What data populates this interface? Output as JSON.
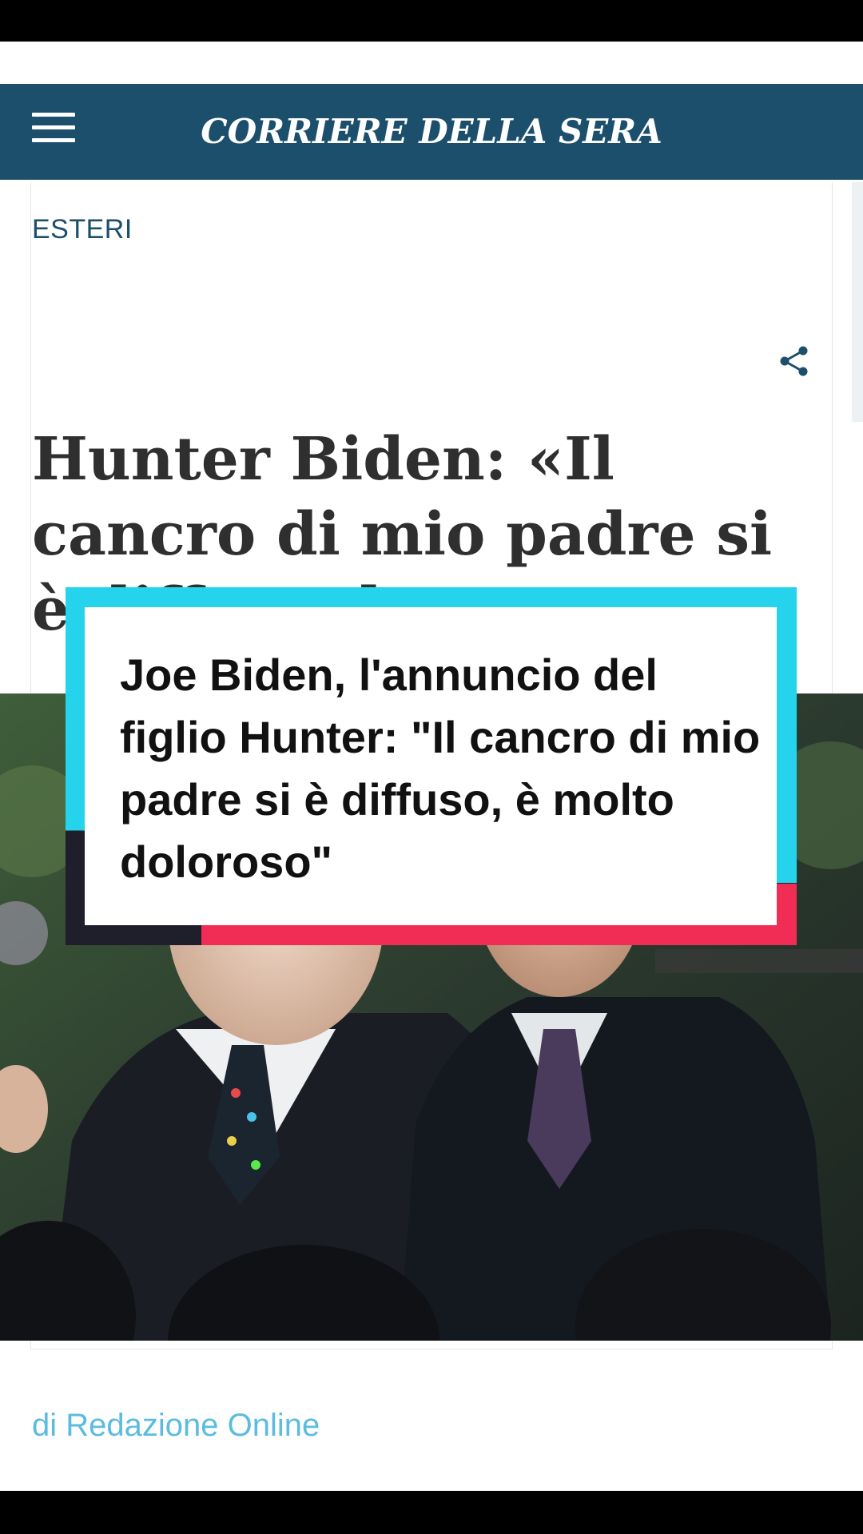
{
  "header": {
    "logo": "CORRIERE DELLA SERA",
    "menu_icon": "hamburger-menu-icon",
    "background_color": "#1b4f6b"
  },
  "article": {
    "category": "ESTERI",
    "share_icon": "share-icon",
    "headline": "Hunter Biden: «Il cancro di mio padre si è diffuso, ha m",
    "byline": "di Redazione Online"
  },
  "overlay": {
    "text": "Joe Biden, l'annuncio del figlio Hunter: \"Il cancro di mio padre si è diffuso, è molto doloroso\"",
    "accent_cyan": "#25d4ec",
    "accent_red": "#f12d55"
  },
  "photo": {
    "description_icon": "news-photo"
  }
}
